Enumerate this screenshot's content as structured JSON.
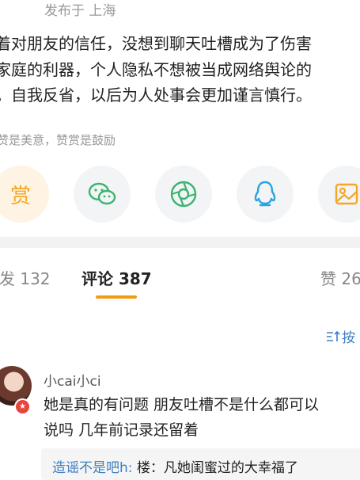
{
  "post": {
    "published": "发布于 上海",
    "lines": [
      "着对朋友的信任，没想到聊天吐槽成为了伤害",
      "家庭的利器，个人隐私不想被当成网络舆论的",
      "。自我反省，以后为人处事会更加谨言慎行。"
    ]
  },
  "reward_hint": "赞是美意，赞赏是鼓励",
  "share": {
    "reward_label": "赏",
    "icons": [
      "reward-icon",
      "wechat-icon",
      "moments-icon",
      "qq-icon",
      "photo-icon"
    ],
    "colors": {
      "reward": "#f5a623",
      "wechat": "#3cb371",
      "moments": "#3cb371",
      "qq": "#29a3e0",
      "photo": "#f5a623"
    }
  },
  "tabs": {
    "repost": "发 132",
    "comments": "评论 387",
    "likes": "赞 26",
    "active": "comments"
  },
  "sort_label": "按",
  "comment": {
    "username": "小cai小ci",
    "lines": [
      "她是真的有问题 朋友吐槽不是什么都可以",
      "说吗 几年前记录还留着"
    ],
    "reply_user": "造谣不是吧h:",
    "reply_text": "楼：凡她闺蜜过的大幸福了"
  },
  "colors": {
    "accent": "#f29b10",
    "link": "#3d7fc1",
    "muted": "#999999"
  }
}
